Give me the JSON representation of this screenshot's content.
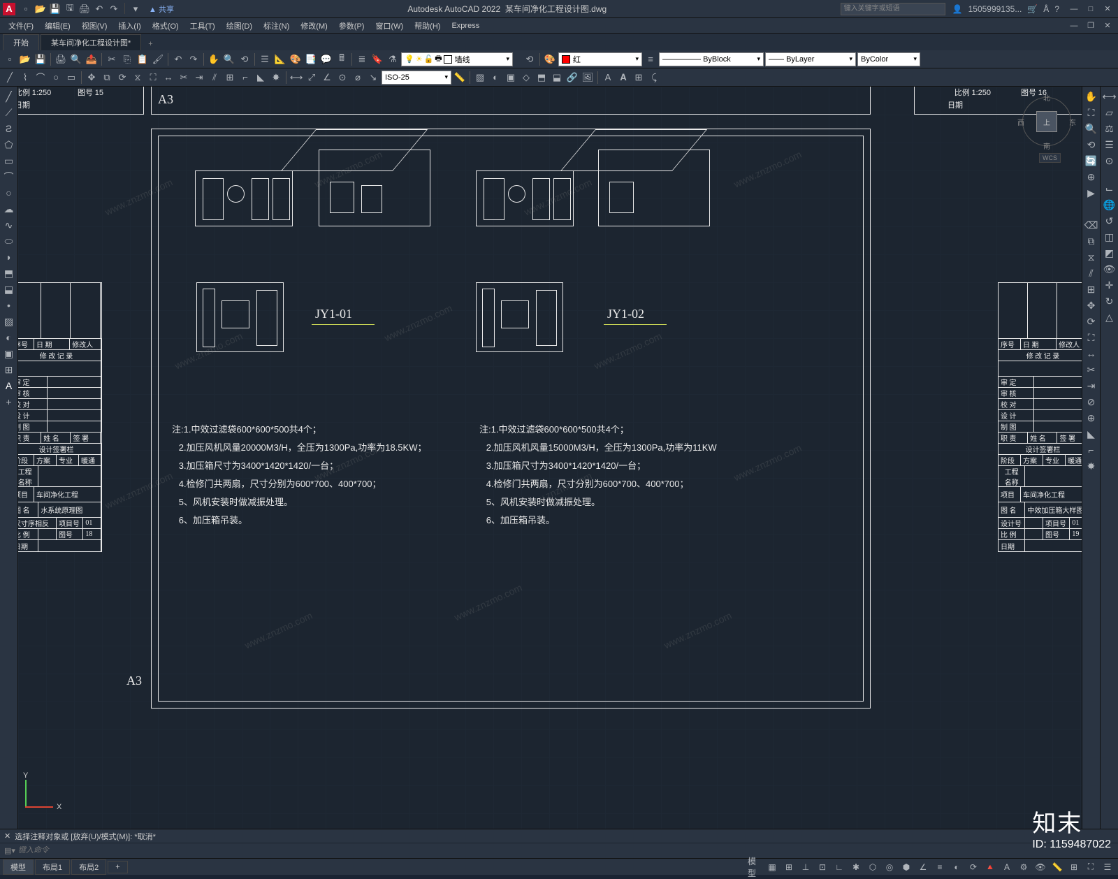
{
  "app": {
    "logo": "A",
    "title_app": "Autodesk AutoCAD 2022",
    "title_doc": "某车间净化工程设计图.dwg",
    "share": "共享",
    "search_placeholder": "键入关键字或短语",
    "username": "1505999135...",
    "win": {
      "min": "—",
      "max": "□",
      "close": "✕"
    }
  },
  "menu": [
    "文件(F)",
    "编辑(E)",
    "视图(V)",
    "插入(I)",
    "格式(O)",
    "工具(T)",
    "绘图(D)",
    "标注(N)",
    "修改(M)",
    "参数(P)",
    "窗口(W)",
    "帮助(H)",
    "Express"
  ],
  "tabs": {
    "start": "开始",
    "doc": "某车间净化工程设计图*"
  },
  "qat_icons": [
    "new-icon",
    "open-icon",
    "save-icon",
    "saveas-icon",
    "plot-icon",
    "undo-icon",
    "redo-icon"
  ],
  "toolbar1_icons": [
    "new",
    "open",
    "save",
    "saveall",
    "plot",
    "preview",
    "publish",
    "3dprint",
    "cut",
    "copy",
    "paste",
    "matchprop",
    "undo",
    "redo",
    "pan",
    "zoom",
    "zoomprev",
    "properties",
    "designcenter",
    "toolpalettes",
    "sheetset",
    "markup",
    "qcalc",
    "help"
  ],
  "layer": {
    "current": "墙线",
    "color": "红"
  },
  "props": {
    "lineweight": "ByBlock",
    "linetype": "ByLayer",
    "plotstyle": "ByColor"
  },
  "dimstyle": "ISO-25",
  "left_tools": [
    "line",
    "pline",
    "circle",
    "arc",
    "rect",
    "polygon",
    "ellipse",
    "hatch",
    "spline",
    "point",
    "block",
    "table",
    "mtext",
    "region",
    "wipeout",
    "revcloud"
  ],
  "right_tools": [
    "pan",
    "zoom-extents",
    "zoom-window",
    "zoom-prev",
    "orbit",
    "steering",
    "showmotion"
  ],
  "right_tools2": [
    "dist",
    "area",
    "region-prop",
    "list",
    "id",
    "ucs",
    "ucs-world",
    "ucs-prev",
    "ucs-obj",
    "view-top",
    "view-front",
    "view-iso"
  ],
  "drawing": {
    "sheet_label": "A3",
    "jy1": "JY1-01",
    "jy2": "JY1-02",
    "notes1_title": "注:",
    "notes1": [
      "1.中效过滤袋600*600*500共4个；",
      "2.加压风机风量20000M3/H，全压为1300Pa,功率为18.5KW；",
      "3.加压箱尺寸为3400*1420*1420/一台；",
      "4.检修门共两扇，尺寸分别为600*700、400*700；",
      "5、风机安装时做减振处理。",
      "6、加压箱吊装。"
    ],
    "notes2_title": "注:",
    "notes2": [
      "1.中效过滤袋600*600*500共4个；",
      "2.加压风机风量15000M3/H，全压为1300Pa,功率为11KW",
      "3.加压箱尺寸为3400*1420*1420/一台；",
      "4.检修门共两扇，尺寸分别为600*700、400*700；",
      "5、风机安装时做减振处理。",
      "6、加压箱吊装。"
    ],
    "scale": "1:250",
    "tb_left_top": {
      "scale_lbl": "比例",
      "scale_val": "1:250",
      "sheet_lbl": "图号",
      "sheet_val": "15",
      "date_lbl": "日期"
    },
    "tb_right_top": {
      "scale_lbl": "比例",
      "scale_val": "1:250",
      "sheet_lbl": "图号",
      "sheet_val": "16",
      "date_lbl": "日期"
    },
    "tb_left": {
      "seq": "序号",
      "date": "日 期",
      "rev_person": "修改人",
      "rev_record": "修 改 记 录",
      "shending": "审 定",
      "shenhe": "审 核",
      "jiaodui": "校 对",
      "sheji": "设 计",
      "zhitu": "制 图",
      "zhize": "职 责",
      "xingming": "姓 名",
      "qianshu": "签 署",
      "sjc": "设计签署栏",
      "jieduan": "阶段",
      "fangan": "方案",
      "zhuanye": "专业",
      "nuantong": "暖通",
      "gongcheng": "工程",
      "mingcheng": "名称",
      "project_lbl": "项目",
      "project_val": "车间净化工程",
      "drawing_lbl": "图 名",
      "drawing_val": "水系统原理图",
      "ckx": "尺寸序相反",
      "xiangmuhao": "项目号",
      "xm_val": "01",
      "bili": "比 例",
      "tuhao": "图号",
      "tuhao_val": "18",
      "riqi": "日期"
    },
    "tb_right": {
      "seq": "序号",
      "date": "日 期",
      "rev_person": "修改人",
      "rev_record": "修 改 记 录",
      "shending": "审 定",
      "shenhe": "审 核",
      "jiaodui": "校 对",
      "sheji": "设 计",
      "zhitu": "制 图",
      "zhize": "职 责",
      "xingming": "姓 名",
      "qianshu": "签 署",
      "sjc": "设计签署栏",
      "jieduan": "阶段",
      "fangan": "方案",
      "zhuanye": "专业",
      "nuantong": "暖通",
      "gongcheng": "工程",
      "mingcheng": "名称",
      "project_lbl": "项目",
      "project_val": "车间净化工程",
      "drawing_lbl": "图 名",
      "drawing_val": "中效加压箱大样图",
      "shejihao": "设计号",
      "xiangmuhao": "项目号",
      "xm_val": "01",
      "bili": "比 例",
      "tuhao": "图号",
      "tuhao_val": "19",
      "riqi": "日期"
    }
  },
  "viewcube": {
    "top": "上",
    "n": "北",
    "s": "南",
    "e": "东",
    "w": "西",
    "wcs": "WCS"
  },
  "ucs": {
    "x": "X",
    "y": "Y"
  },
  "cmd": {
    "history": "选择注释对象或 [放弃(U)/模式(M)]: *取消*",
    "prompt_icon": "▸",
    "placeholder": "键入命令"
  },
  "status": {
    "tabs": [
      "模型",
      "布局1",
      "布局2"
    ],
    "plus": "+",
    "right": [
      "model",
      "grid",
      "snap",
      "infer",
      "dyn",
      "ortho",
      "polar",
      "iso",
      "osnap",
      "3dosnap",
      "otrack",
      "lwt",
      "transp",
      "cycling",
      "ann",
      "auto",
      "ws",
      "monitor",
      "units",
      "clean",
      "custom"
    ]
  },
  "watermark": {
    "url": "www.znzmo.com",
    "brand": "知末",
    "id": "ID: 1159487022"
  }
}
